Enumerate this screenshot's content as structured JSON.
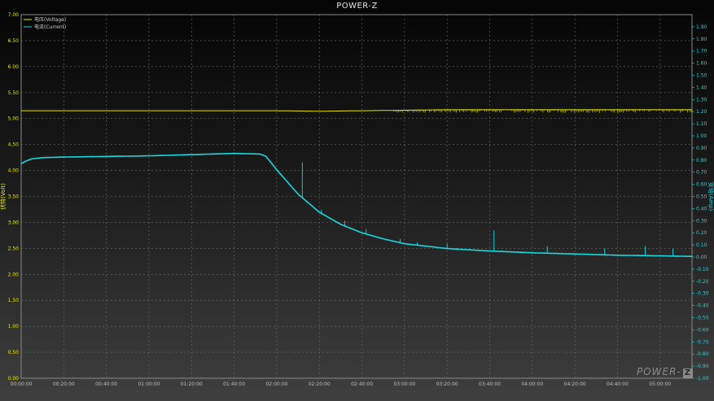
{
  "app": {
    "title": "POWER-Z",
    "watermark": "POWER-Z"
  },
  "colors": {
    "voltage": "#e6e600",
    "current": "#18d8e0",
    "left_axis_text": "#e6e600",
    "right_axis_text": "#18d8e0",
    "grid": "#6a6a6a"
  },
  "chart_data": {
    "type": "line",
    "title": "POWER-Z",
    "ylabel": "伏特(Volt)",
    "y2label": "安培(Amp)",
    "xlim_minutes": [
      0,
      315
    ],
    "ylim": [
      0,
      7
    ],
    "y2lim": [
      -1,
      2
    ],
    "grid": true,
    "legend_position": "top-left",
    "x_tick_labels": [
      "00:00:00",
      "00:20:00",
      "00:40:00",
      "01:00:00",
      "01:20:00",
      "01:40:00",
      "02:00:00",
      "02:20:00",
      "02:40:00",
      "03:00:00",
      "03:20:00",
      "03:40:00",
      "04:00:00",
      "04:20:00",
      "04:40:00",
      "05:00:00"
    ],
    "y_tick_labels": [
      "0.00",
      "0.50",
      "1.00",
      "1.50",
      "2.00",
      "2.50",
      "3.00",
      "3.50",
      "4.00",
      "4.50",
      "5.00",
      "5.50",
      "6.00",
      "6.50",
      "7.00"
    ],
    "y2_tick_labels": [
      "-1.00",
      "-0.90",
      "-0.80",
      "-0.70",
      "-0.60",
      "-0.50",
      "-0.40",
      "-0.30",
      "-0.20",
      "-0.10",
      "0.00",
      "0.10",
      "0.20",
      "0.30",
      "0.40",
      "0.50",
      "0.60",
      "0.70",
      "0.80",
      "0.90",
      "1.00",
      "1.10",
      "1.20",
      "1.30",
      "1.40",
      "1.50",
      "1.60",
      "1.70",
      "1.80",
      "1.90"
    ],
    "series": [
      {
        "name": "电压(Voltage)",
        "axis": "left",
        "x_minutes": [
          0,
          20,
          40,
          60,
          80,
          100,
          120,
          140,
          160,
          180,
          200,
          220,
          240,
          260,
          280,
          300,
          315
        ],
        "values": [
          5.15,
          5.15,
          5.15,
          5.15,
          5.15,
          5.15,
          5.15,
          5.14,
          5.15,
          5.16,
          5.17,
          5.17,
          5.17,
          5.17,
          5.17,
          5.17,
          5.17
        ],
        "noise_from_minute": 175,
        "noise_min": 5.11
      },
      {
        "name": "电流(Current)",
        "axis": "right",
        "x_minutes": [
          0,
          2,
          5,
          10,
          20,
          40,
          60,
          80,
          90,
          100,
          112,
          115,
          120,
          130,
          140,
          150,
          160,
          170,
          180,
          190,
          200,
          220,
          240,
          260,
          280,
          300,
          315
        ],
        "values": [
          0.77,
          0.79,
          0.81,
          0.82,
          0.825,
          0.83,
          0.835,
          0.845,
          0.85,
          0.855,
          0.85,
          0.83,
          0.72,
          0.52,
          0.37,
          0.27,
          0.2,
          0.15,
          0.11,
          0.09,
          0.07,
          0.05,
          0.035,
          0.025,
          0.015,
          0.01,
          0.005
        ],
        "spikes": [
          {
            "x_minute": 132,
            "value": 0.78
          },
          {
            "x_minute": 141,
            "value": 0.39
          },
          {
            "x_minute": 152,
            "value": 0.3
          },
          {
            "x_minute": 162,
            "value": 0.23
          },
          {
            "x_minute": 178,
            "value": 0.15
          },
          {
            "x_minute": 186,
            "value": 0.12
          },
          {
            "x_minute": 200,
            "value": 0.11
          },
          {
            "x_minute": 222,
            "value": 0.22
          },
          {
            "x_minute": 247,
            "value": 0.09
          },
          {
            "x_minute": 274,
            "value": 0.07
          },
          {
            "x_minute": 293,
            "value": 0.09
          },
          {
            "x_minute": 306,
            "value": 0.07
          }
        ]
      }
    ]
  }
}
